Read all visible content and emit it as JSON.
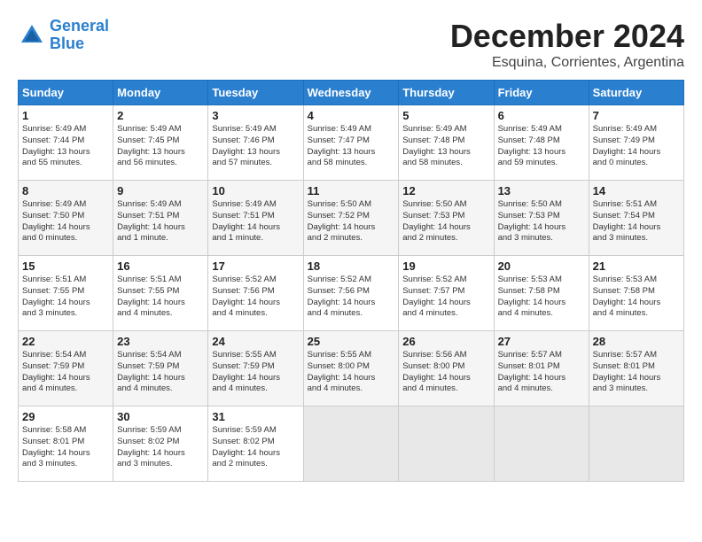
{
  "logo": {
    "line1": "General",
    "line2": "Blue"
  },
  "title": "December 2024",
  "location": "Esquina, Corrientes, Argentina",
  "weekdays": [
    "Sunday",
    "Monday",
    "Tuesday",
    "Wednesday",
    "Thursday",
    "Friday",
    "Saturday"
  ],
  "weeks": [
    [
      {
        "day": "1",
        "info": "Sunrise: 5:49 AM\nSunset: 7:44 PM\nDaylight: 13 hours\nand 55 minutes."
      },
      {
        "day": "2",
        "info": "Sunrise: 5:49 AM\nSunset: 7:45 PM\nDaylight: 13 hours\nand 56 minutes."
      },
      {
        "day": "3",
        "info": "Sunrise: 5:49 AM\nSunset: 7:46 PM\nDaylight: 13 hours\nand 57 minutes."
      },
      {
        "day": "4",
        "info": "Sunrise: 5:49 AM\nSunset: 7:47 PM\nDaylight: 13 hours\nand 58 minutes."
      },
      {
        "day": "5",
        "info": "Sunrise: 5:49 AM\nSunset: 7:48 PM\nDaylight: 13 hours\nand 58 minutes."
      },
      {
        "day": "6",
        "info": "Sunrise: 5:49 AM\nSunset: 7:48 PM\nDaylight: 13 hours\nand 59 minutes."
      },
      {
        "day": "7",
        "info": "Sunrise: 5:49 AM\nSunset: 7:49 PM\nDaylight: 14 hours\nand 0 minutes."
      }
    ],
    [
      {
        "day": "8",
        "info": "Sunrise: 5:49 AM\nSunset: 7:50 PM\nDaylight: 14 hours\nand 0 minutes."
      },
      {
        "day": "9",
        "info": "Sunrise: 5:49 AM\nSunset: 7:51 PM\nDaylight: 14 hours\nand 1 minute."
      },
      {
        "day": "10",
        "info": "Sunrise: 5:49 AM\nSunset: 7:51 PM\nDaylight: 14 hours\nand 1 minute."
      },
      {
        "day": "11",
        "info": "Sunrise: 5:50 AM\nSunset: 7:52 PM\nDaylight: 14 hours\nand 2 minutes."
      },
      {
        "day": "12",
        "info": "Sunrise: 5:50 AM\nSunset: 7:53 PM\nDaylight: 14 hours\nand 2 minutes."
      },
      {
        "day": "13",
        "info": "Sunrise: 5:50 AM\nSunset: 7:53 PM\nDaylight: 14 hours\nand 3 minutes."
      },
      {
        "day": "14",
        "info": "Sunrise: 5:51 AM\nSunset: 7:54 PM\nDaylight: 14 hours\nand 3 minutes."
      }
    ],
    [
      {
        "day": "15",
        "info": "Sunrise: 5:51 AM\nSunset: 7:55 PM\nDaylight: 14 hours\nand 3 minutes."
      },
      {
        "day": "16",
        "info": "Sunrise: 5:51 AM\nSunset: 7:55 PM\nDaylight: 14 hours\nand 4 minutes."
      },
      {
        "day": "17",
        "info": "Sunrise: 5:52 AM\nSunset: 7:56 PM\nDaylight: 14 hours\nand 4 minutes."
      },
      {
        "day": "18",
        "info": "Sunrise: 5:52 AM\nSunset: 7:56 PM\nDaylight: 14 hours\nand 4 minutes."
      },
      {
        "day": "19",
        "info": "Sunrise: 5:52 AM\nSunset: 7:57 PM\nDaylight: 14 hours\nand 4 minutes."
      },
      {
        "day": "20",
        "info": "Sunrise: 5:53 AM\nSunset: 7:58 PM\nDaylight: 14 hours\nand 4 minutes."
      },
      {
        "day": "21",
        "info": "Sunrise: 5:53 AM\nSunset: 7:58 PM\nDaylight: 14 hours\nand 4 minutes."
      }
    ],
    [
      {
        "day": "22",
        "info": "Sunrise: 5:54 AM\nSunset: 7:59 PM\nDaylight: 14 hours\nand 4 minutes."
      },
      {
        "day": "23",
        "info": "Sunrise: 5:54 AM\nSunset: 7:59 PM\nDaylight: 14 hours\nand 4 minutes."
      },
      {
        "day": "24",
        "info": "Sunrise: 5:55 AM\nSunset: 7:59 PM\nDaylight: 14 hours\nand 4 minutes."
      },
      {
        "day": "25",
        "info": "Sunrise: 5:55 AM\nSunset: 8:00 PM\nDaylight: 14 hours\nand 4 minutes."
      },
      {
        "day": "26",
        "info": "Sunrise: 5:56 AM\nSunset: 8:00 PM\nDaylight: 14 hours\nand 4 minutes."
      },
      {
        "day": "27",
        "info": "Sunrise: 5:57 AM\nSunset: 8:01 PM\nDaylight: 14 hours\nand 4 minutes."
      },
      {
        "day": "28",
        "info": "Sunrise: 5:57 AM\nSunset: 8:01 PM\nDaylight: 14 hours\nand 3 minutes."
      }
    ],
    [
      {
        "day": "29",
        "info": "Sunrise: 5:58 AM\nSunset: 8:01 PM\nDaylight: 14 hours\nand 3 minutes."
      },
      {
        "day": "30",
        "info": "Sunrise: 5:59 AM\nSunset: 8:02 PM\nDaylight: 14 hours\nand 3 minutes."
      },
      {
        "day": "31",
        "info": "Sunrise: 5:59 AM\nSunset: 8:02 PM\nDaylight: 14 hours\nand 2 minutes."
      },
      {
        "day": "",
        "info": ""
      },
      {
        "day": "",
        "info": ""
      },
      {
        "day": "",
        "info": ""
      },
      {
        "day": "",
        "info": ""
      }
    ]
  ]
}
